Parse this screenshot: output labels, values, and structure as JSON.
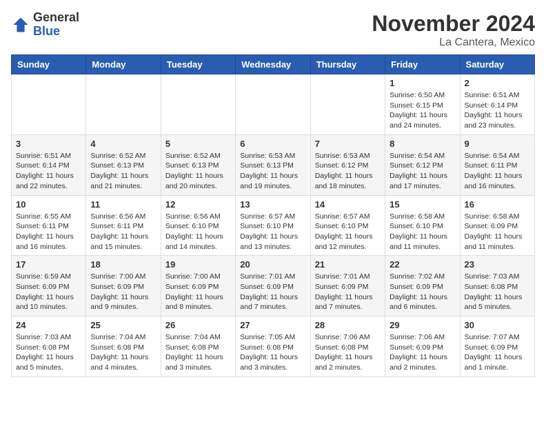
{
  "logo": {
    "general": "General",
    "blue": "Blue"
  },
  "title": "November 2024",
  "location": "La Cantera, Mexico",
  "days_of_week": [
    "Sunday",
    "Monday",
    "Tuesday",
    "Wednesday",
    "Thursday",
    "Friday",
    "Saturday"
  ],
  "weeks": [
    [
      {
        "day": "",
        "info": ""
      },
      {
        "day": "",
        "info": ""
      },
      {
        "day": "",
        "info": ""
      },
      {
        "day": "",
        "info": ""
      },
      {
        "day": "",
        "info": ""
      },
      {
        "day": "1",
        "info": "Sunrise: 6:50 AM\nSunset: 6:15 PM\nDaylight: 11 hours\nand 24 minutes."
      },
      {
        "day": "2",
        "info": "Sunrise: 6:51 AM\nSunset: 6:14 PM\nDaylight: 11 hours\nand 23 minutes."
      }
    ],
    [
      {
        "day": "3",
        "info": "Sunrise: 6:51 AM\nSunset: 6:14 PM\nDaylight: 11 hours\nand 22 minutes."
      },
      {
        "day": "4",
        "info": "Sunrise: 6:52 AM\nSunset: 6:13 PM\nDaylight: 11 hours\nand 21 minutes."
      },
      {
        "day": "5",
        "info": "Sunrise: 6:52 AM\nSunset: 6:13 PM\nDaylight: 11 hours\nand 20 minutes."
      },
      {
        "day": "6",
        "info": "Sunrise: 6:53 AM\nSunset: 6:13 PM\nDaylight: 11 hours\nand 19 minutes."
      },
      {
        "day": "7",
        "info": "Sunrise: 6:53 AM\nSunset: 6:12 PM\nDaylight: 11 hours\nand 18 minutes."
      },
      {
        "day": "8",
        "info": "Sunrise: 6:54 AM\nSunset: 6:12 PM\nDaylight: 11 hours\nand 17 minutes."
      },
      {
        "day": "9",
        "info": "Sunrise: 6:54 AM\nSunset: 6:11 PM\nDaylight: 11 hours\nand 16 minutes."
      }
    ],
    [
      {
        "day": "10",
        "info": "Sunrise: 6:55 AM\nSunset: 6:11 PM\nDaylight: 11 hours\nand 16 minutes."
      },
      {
        "day": "11",
        "info": "Sunrise: 6:56 AM\nSunset: 6:11 PM\nDaylight: 11 hours\nand 15 minutes."
      },
      {
        "day": "12",
        "info": "Sunrise: 6:56 AM\nSunset: 6:10 PM\nDaylight: 11 hours\nand 14 minutes."
      },
      {
        "day": "13",
        "info": "Sunrise: 6:57 AM\nSunset: 6:10 PM\nDaylight: 11 hours\nand 13 minutes."
      },
      {
        "day": "14",
        "info": "Sunrise: 6:57 AM\nSunset: 6:10 PM\nDaylight: 11 hours\nand 12 minutes."
      },
      {
        "day": "15",
        "info": "Sunrise: 6:58 AM\nSunset: 6:10 PM\nDaylight: 11 hours\nand 11 minutes."
      },
      {
        "day": "16",
        "info": "Sunrise: 6:58 AM\nSunset: 6:09 PM\nDaylight: 11 hours\nand 11 minutes."
      }
    ],
    [
      {
        "day": "17",
        "info": "Sunrise: 6:59 AM\nSunset: 6:09 PM\nDaylight: 11 hours\nand 10 minutes."
      },
      {
        "day": "18",
        "info": "Sunrise: 7:00 AM\nSunset: 6:09 PM\nDaylight: 11 hours\nand 9 minutes."
      },
      {
        "day": "19",
        "info": "Sunrise: 7:00 AM\nSunset: 6:09 PM\nDaylight: 11 hours\nand 8 minutes."
      },
      {
        "day": "20",
        "info": "Sunrise: 7:01 AM\nSunset: 6:09 PM\nDaylight: 11 hours\nand 7 minutes."
      },
      {
        "day": "21",
        "info": "Sunrise: 7:01 AM\nSunset: 6:09 PM\nDaylight: 11 hours\nand 7 minutes."
      },
      {
        "day": "22",
        "info": "Sunrise: 7:02 AM\nSunset: 6:09 PM\nDaylight: 11 hours\nand 6 minutes."
      },
      {
        "day": "23",
        "info": "Sunrise: 7:03 AM\nSunset: 6:08 PM\nDaylight: 11 hours\nand 5 minutes."
      }
    ],
    [
      {
        "day": "24",
        "info": "Sunrise: 7:03 AM\nSunset: 6:08 PM\nDaylight: 11 hours\nand 5 minutes."
      },
      {
        "day": "25",
        "info": "Sunrise: 7:04 AM\nSunset: 6:08 PM\nDaylight: 11 hours\nand 4 minutes."
      },
      {
        "day": "26",
        "info": "Sunrise: 7:04 AM\nSunset: 6:08 PM\nDaylight: 11 hours\nand 3 minutes."
      },
      {
        "day": "27",
        "info": "Sunrise: 7:05 AM\nSunset: 6:08 PM\nDaylight: 11 hours\nand 3 minutes."
      },
      {
        "day": "28",
        "info": "Sunrise: 7:06 AM\nSunset: 6:08 PM\nDaylight: 11 hours\nand 2 minutes."
      },
      {
        "day": "29",
        "info": "Sunrise: 7:06 AM\nSunset: 6:09 PM\nDaylight: 11 hours\nand 2 minutes."
      },
      {
        "day": "30",
        "info": "Sunrise: 7:07 AM\nSunset: 6:09 PM\nDaylight: 11 hours\nand 1 minute."
      }
    ]
  ]
}
